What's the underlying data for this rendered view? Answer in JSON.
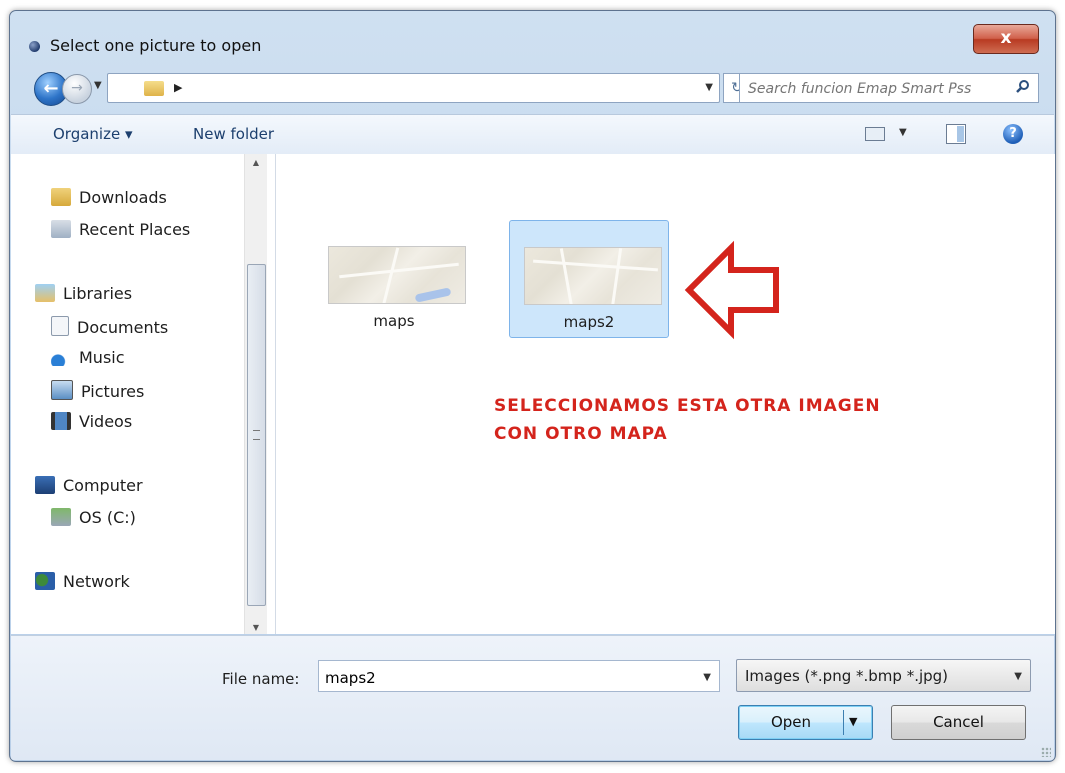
{
  "window": {
    "title": "Select one picture to open",
    "close_glyph": "x"
  },
  "nav": {
    "back_glyph": "←",
    "search_placeholder": "Search funcion Emap Smart Pss",
    "refresh_glyph": "↻"
  },
  "toolbar": {
    "organize_label": "Organize ▾",
    "new_folder_label": "New folder",
    "help_glyph": "?"
  },
  "sidebar": {
    "items": [
      {
        "label": "Downloads",
        "icon": "downloads-icon"
      },
      {
        "label": "Recent Places",
        "icon": "recent-places-icon"
      },
      {
        "label": "Libraries",
        "icon": "libraries-icon"
      },
      {
        "label": "Documents",
        "icon": "documents-icon"
      },
      {
        "label": "Music",
        "icon": "music-icon"
      },
      {
        "label": "Pictures",
        "icon": "pictures-icon"
      },
      {
        "label": "Videos",
        "icon": "videos-icon"
      },
      {
        "label": "Computer",
        "icon": "computer-icon"
      },
      {
        "label": "OS (C:)",
        "icon": "drive-icon"
      },
      {
        "label": "Network",
        "icon": "network-icon"
      }
    ]
  },
  "files": [
    {
      "name": "maps",
      "selected": false
    },
    {
      "name": "maps2",
      "selected": true
    }
  ],
  "annotation": {
    "line1": "SELECCIONAMOS ESTA OTRA IMAGEN",
    "line2": "CON OTRO MAPA",
    "color": "#d4241c"
  },
  "footer": {
    "file_name_label": "File name:",
    "file_name_value": "maps2",
    "filter_value": "Images (*.png *.bmp *.jpg)",
    "open_label": "Open",
    "cancel_label": "Cancel"
  },
  "colors": {
    "selection": "#cde6fb",
    "accent": "#3c7fb1",
    "close": "#c8472f"
  }
}
